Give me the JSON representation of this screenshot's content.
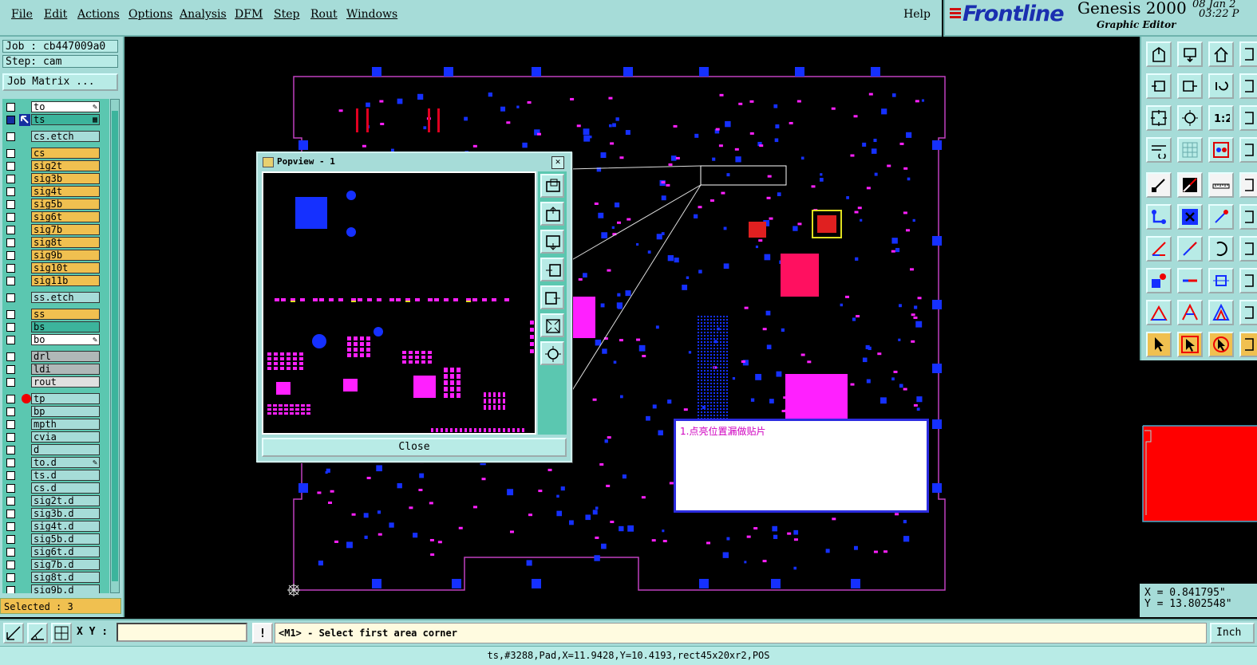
{
  "menu": {
    "items": [
      "File",
      "Edit",
      "Actions",
      "Options",
      "Analysis",
      "DFM",
      "Step",
      "Rout",
      "Windows"
    ],
    "help": "Help"
  },
  "brand": {
    "logo": "Frontline",
    "product": "Genesis 2000",
    "subtitle": "Graphic Editor",
    "date": "08 Jan 2",
    "time": "03:22 P"
  },
  "job": {
    "job_label": "Job : cb447009a0",
    "step_label": "Step: cam",
    "matrix_button": "Job Matrix ..."
  },
  "layers": [
    {
      "name": "to",
      "color": "#ffffff",
      "flag": "✎"
    },
    {
      "name": "ts",
      "color": "#3cb49c",
      "flag": "▦",
      "active": true
    },
    {
      "name": "cs.etch",
      "color": "#a6dcd8"
    },
    {
      "name": "cs",
      "color": "#f0c050"
    },
    {
      "name": "sig2t",
      "color": "#f0c050"
    },
    {
      "name": "sig3b",
      "color": "#f0c050"
    },
    {
      "name": "sig4t",
      "color": "#f0c050"
    },
    {
      "name": "sig5b",
      "color": "#f0c050"
    },
    {
      "name": "sig6t",
      "color": "#f0c050"
    },
    {
      "name": "sig7b",
      "color": "#f0c050"
    },
    {
      "name": "sig8t",
      "color": "#f0c050"
    },
    {
      "name": "sig9b",
      "color": "#f0c050"
    },
    {
      "name": "sig10t",
      "color": "#f0c050"
    },
    {
      "name": "sig11b",
      "color": "#f0c050"
    },
    {
      "name": "ss.etch",
      "color": "#a6dcd8"
    },
    {
      "name": "ss",
      "color": "#f0c050"
    },
    {
      "name": "bs",
      "color": "#3cb49c"
    },
    {
      "name": "bo",
      "color": "#ffffff",
      "flag": "✎"
    },
    {
      "name": "drl",
      "color": "#b0b8b8"
    },
    {
      "name": "ldi",
      "color": "#b0b8b8"
    },
    {
      "name": "rout",
      "color": "#e0e0e0"
    },
    {
      "name": "tp",
      "color": "#a6dcd8",
      "dot": true
    },
    {
      "name": "bp",
      "color": "#a6dcd8"
    },
    {
      "name": "mpth",
      "color": "#a6dcd8"
    },
    {
      "name": "cvia",
      "color": "#a6dcd8"
    },
    {
      "name": "d",
      "color": "#a6dcd8"
    },
    {
      "name": "to.d",
      "color": "#a6dcd8",
      "flag": "✎"
    },
    {
      "name": "ts.d",
      "color": "#a6dcd8"
    },
    {
      "name": "cs.d",
      "color": "#a6dcd8"
    },
    {
      "name": "sig2t.d",
      "color": "#a6dcd8"
    },
    {
      "name": "sig3b.d",
      "color": "#a6dcd8"
    },
    {
      "name": "sig4t.d",
      "color": "#a6dcd8"
    },
    {
      "name": "sig5b.d",
      "color": "#a6dcd8"
    },
    {
      "name": "sig6t.d",
      "color": "#a6dcd8"
    },
    {
      "name": "sig7b.d",
      "color": "#a6dcd8"
    },
    {
      "name": "sig8t.d",
      "color": "#a6dcd8"
    },
    {
      "name": "sig9b.d",
      "color": "#a6dcd8"
    }
  ],
  "selected": "Selected : 3",
  "popview": {
    "title": "Popview - 1",
    "close_label": "Close"
  },
  "note": "1.点亮位置漏做贴片",
  "coords": {
    "x": "X = 0.841795\"",
    "y": "Y = 13.802548\""
  },
  "bottom": {
    "xy_label": "X Y :",
    "xy_value": "",
    "prompt": "<M1> - Select first area corner",
    "units": "Inch"
  },
  "status": "ts,#3288,Pad,X=11.9428,Y=10.4193,rect45x20xr2,POS",
  "colors": {
    "panel": "#a6dcd8",
    "pad_blue": "#1530ff",
    "pad_magenta": "#ff20ff",
    "outline": "#c040c0"
  }
}
